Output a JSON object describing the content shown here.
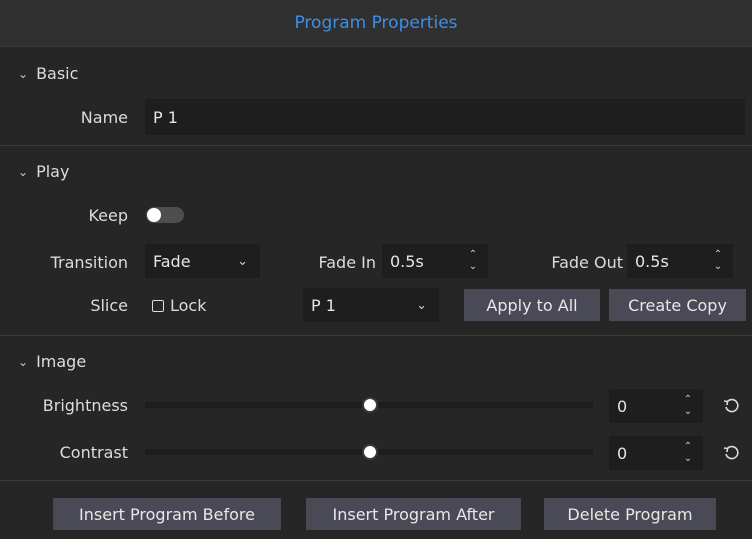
{
  "panel": {
    "title": "Program Properties"
  },
  "sections": {
    "basic": {
      "label": "Basic"
    },
    "play": {
      "label": "Play"
    },
    "image": {
      "label": "Image"
    }
  },
  "basic": {
    "name_label": "Name",
    "name_value": "P 1"
  },
  "play": {
    "keep_label": "Keep",
    "keep_on": false,
    "transition_label": "Transition",
    "transition_value": "Fade",
    "fade_in_label": "Fade In",
    "fade_in_value": "0.5s",
    "fade_out_label": "Fade Out",
    "fade_out_value": "0.5s",
    "slice_label": "Slice",
    "lock_label": "Lock",
    "lock_checked": false,
    "slice_value": "P 1",
    "apply_all_label": "Apply to All",
    "create_copy_label": "Create Copy"
  },
  "image": {
    "brightness_label": "Brightness",
    "brightness_value": "0",
    "contrast_label": "Contrast",
    "contrast_value": "0"
  },
  "footer": {
    "insert_before_label": "Insert Program Before",
    "insert_after_label": "Insert Program After",
    "delete_label": "Delete Program"
  },
  "colors": {
    "accent": "#3f8ee6",
    "background": "#262626",
    "field": "#1e1e1e",
    "button": "#4a4a56"
  },
  "icons": [
    "chevron-down-icon",
    "spin-up-icon",
    "spin-down-icon",
    "reset-icon"
  ]
}
